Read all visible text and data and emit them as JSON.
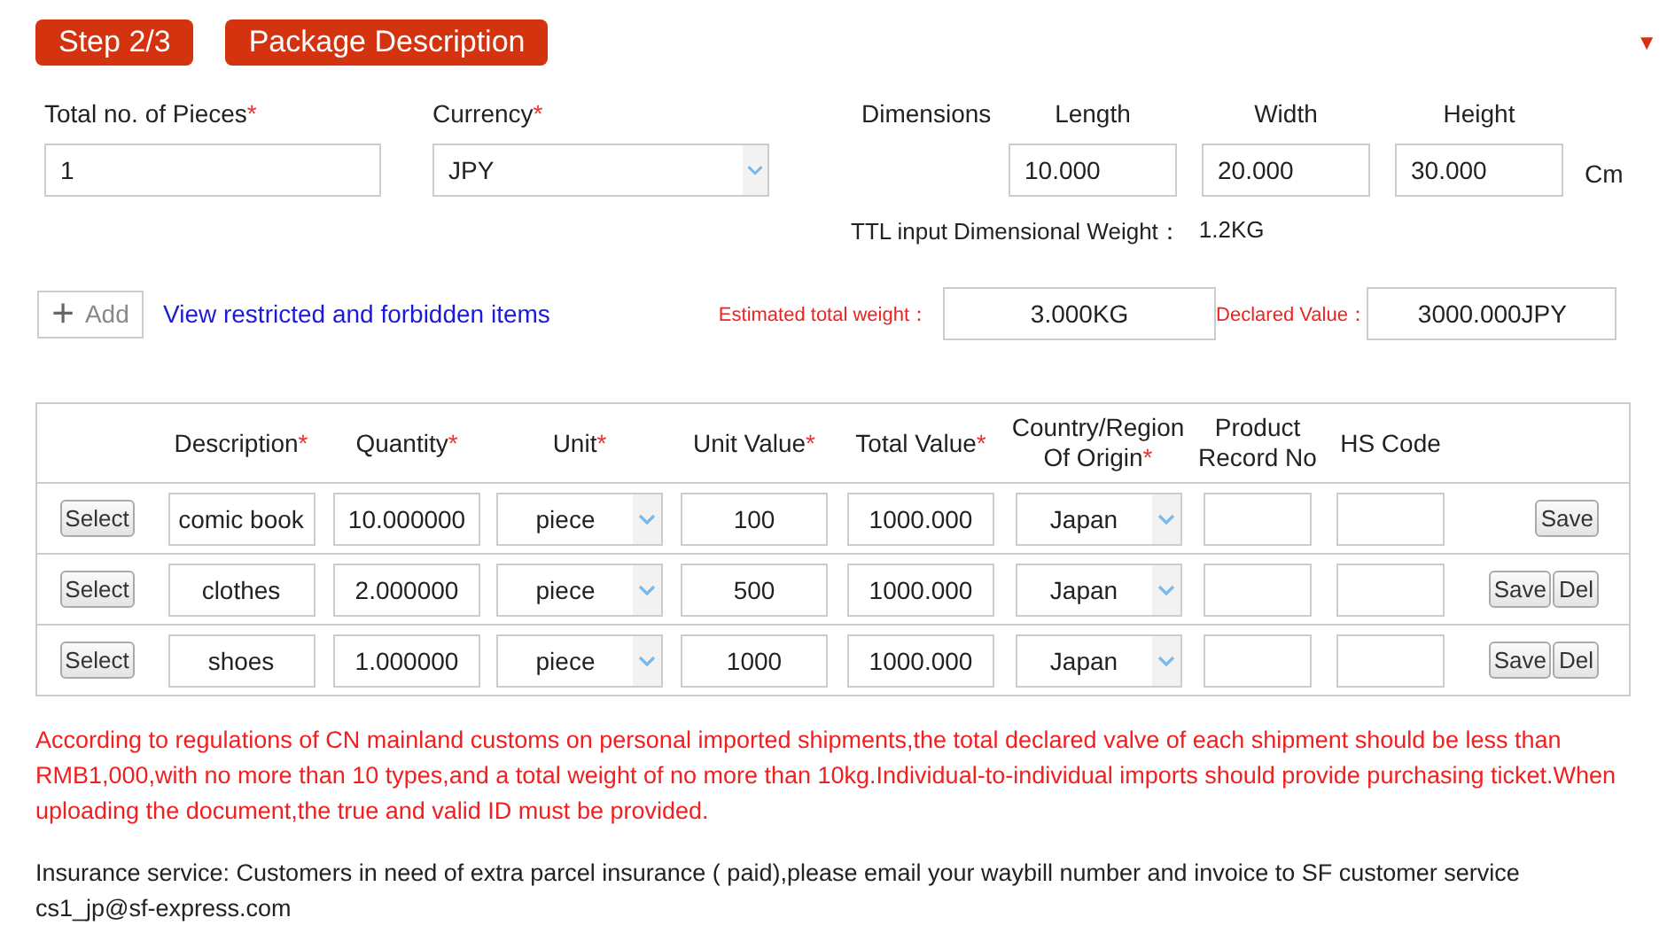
{
  "header": {
    "step": "Step 2/3",
    "title": "Package Description",
    "collapse_glyph": "▼"
  },
  "fields": {
    "pieces": {
      "label": "Total no. of Pieces",
      "mark": "*",
      "value": "1"
    },
    "currency": {
      "label": "Currency",
      "mark": "*",
      "value": "JPY"
    },
    "dimensions_label": "Dimensions",
    "dims": [
      {
        "label": "Length",
        "value": "10.000"
      },
      {
        "label": "Width",
        "value": "20.000"
      },
      {
        "label": "Height",
        "value": "30.000"
      }
    ],
    "unit": "Cm",
    "ttl_label": "TTL input Dimensional Weight：",
    "ttl_value": "1.2KG"
  },
  "actions": {
    "add_glyph": "+",
    "add_label": "Add",
    "link": "View restricted and forbidden items",
    "weight_label": "Estimated total weight：",
    "weight_value": "3.000KG",
    "declared_label": "Declared Value：",
    "declared_value": "3000.000JPY"
  },
  "table": {
    "columns": [
      {
        "label": "Description",
        "mark": "*"
      },
      {
        "label": "Quantity",
        "mark": "*"
      },
      {
        "label": "Unit",
        "mark": "*"
      },
      {
        "label": "Unit Value",
        "mark": "*"
      },
      {
        "label": "Total Value",
        "mark": "*"
      },
      {
        "label": "Country/Region Of Origin",
        "mark": "*"
      },
      {
        "label": "Product Record No"
      },
      {
        "label": "HS Code"
      }
    ],
    "rows": [
      {
        "select": "Select",
        "description": "comic book",
        "quantity": "10.000000",
        "unit": "piece",
        "unit_value": "100",
        "total_value": "1000.000",
        "country": "Japan",
        "buttons": [
          "Save"
        ]
      },
      {
        "select": "Select",
        "description": "clothes",
        "quantity": "2.000000",
        "unit": "piece",
        "unit_value": "500",
        "total_value": "1000.000",
        "country": "Japan",
        "buttons": [
          "Save",
          "Del"
        ]
      },
      {
        "select": "Select",
        "description": "shoes",
        "quantity": "1.000000",
        "unit": "piece",
        "unit_value": "1000",
        "total_value": "1000.000",
        "country": "Japan",
        "buttons": [
          "Save",
          "Del"
        ]
      }
    ]
  },
  "notice": "According to regulations of CN mainland customs on personal imported shipments,the total declared valve of each shipment should be less than RMB1,000,with no more than 10 types,and a total weight of no more than 10kg.Individual-to-individual imports should provide purchasing ticket.When uploading the document,the true and valid ID must be provided.",
  "insurance": "Insurance service: Customers in need of extra parcel insurance ( paid),please email your waybill number and invoice to SF customer service cs1_jp@sf-express.com"
}
